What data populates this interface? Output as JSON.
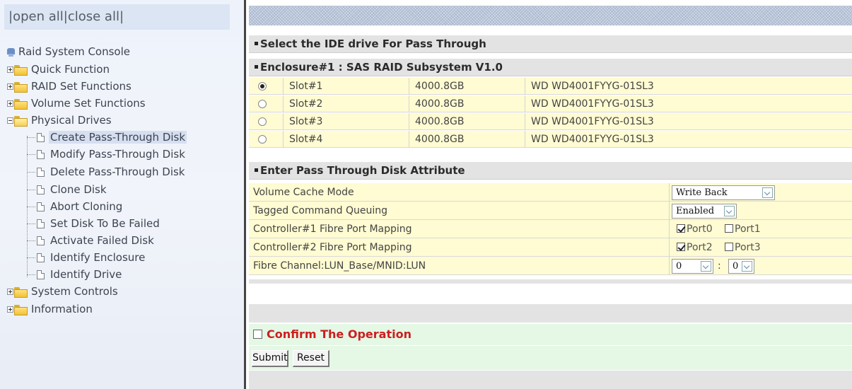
{
  "tree": {
    "open_label": "open all",
    "close_label": "close all",
    "sep": "|",
    "root": "Raid System Console",
    "groups": [
      {
        "label": "Quick Function"
      },
      {
        "label": "RAID Set Functions"
      },
      {
        "label": "Volume Set Functions"
      },
      {
        "label": "Physical Drives"
      },
      {
        "label": "System Controls"
      },
      {
        "label": "Information"
      }
    ],
    "physical_items": [
      {
        "label": "Create Pass-Through Disk"
      },
      {
        "label": "Modify Pass-Through Disk"
      },
      {
        "label": "Delete Pass-Through Disk"
      },
      {
        "label": "Clone Disk"
      },
      {
        "label": "Abort Cloning"
      },
      {
        "label": "Set Disk To Be Failed"
      },
      {
        "label": "Activate Failed Disk"
      },
      {
        "label": "Identify Enclosure"
      },
      {
        "label": "Identify Drive"
      }
    ]
  },
  "main": {
    "select_header": "Select the IDE drive For Pass Through",
    "enclosure_header": "Enclosure#1 : SAS RAID Subsystem V1.0",
    "slots": [
      {
        "slot": "Slot#1",
        "size": "4000.8GB",
        "model": "WD WD4001FYYG-01SL3",
        "selected": true
      },
      {
        "slot": "Slot#2",
        "size": "4000.8GB",
        "model": "WD WD4001FYYG-01SL3",
        "selected": false
      },
      {
        "slot": "Slot#3",
        "size": "4000.8GB",
        "model": "WD WD4001FYYG-01SL3",
        "selected": false
      },
      {
        "slot": "Slot#4",
        "size": "4000.8GB",
        "model": "WD WD4001FYYG-01SL3",
        "selected": false
      }
    ],
    "attr_header": "Enter Pass Through Disk Attribute",
    "attributes": {
      "cache_mode": {
        "label": "Volume Cache Mode",
        "value": "Write Back"
      },
      "tcq": {
        "label": "Tagged Command Queuing",
        "value": "Enabled"
      },
      "ctrl1": {
        "label": "Controller#1 Fibre Port Mapping",
        "port_a": "Port0",
        "port_a_checked": true,
        "port_b": "Port1",
        "port_b_checked": false
      },
      "ctrl2": {
        "label": "Controller#2 Fibre Port Mapping",
        "port_a": "Port2",
        "port_a_checked": true,
        "port_b": "Port3",
        "port_b_checked": false
      },
      "lun": {
        "label": "Fibre Channel:LUN_Base/MNID:LUN",
        "base": "0",
        "sep": ":",
        "lun": "0"
      }
    },
    "confirm_label": "Confirm The Operation",
    "confirm_checked": false,
    "submit_label": "Submit",
    "reset_label": "Reset"
  }
}
